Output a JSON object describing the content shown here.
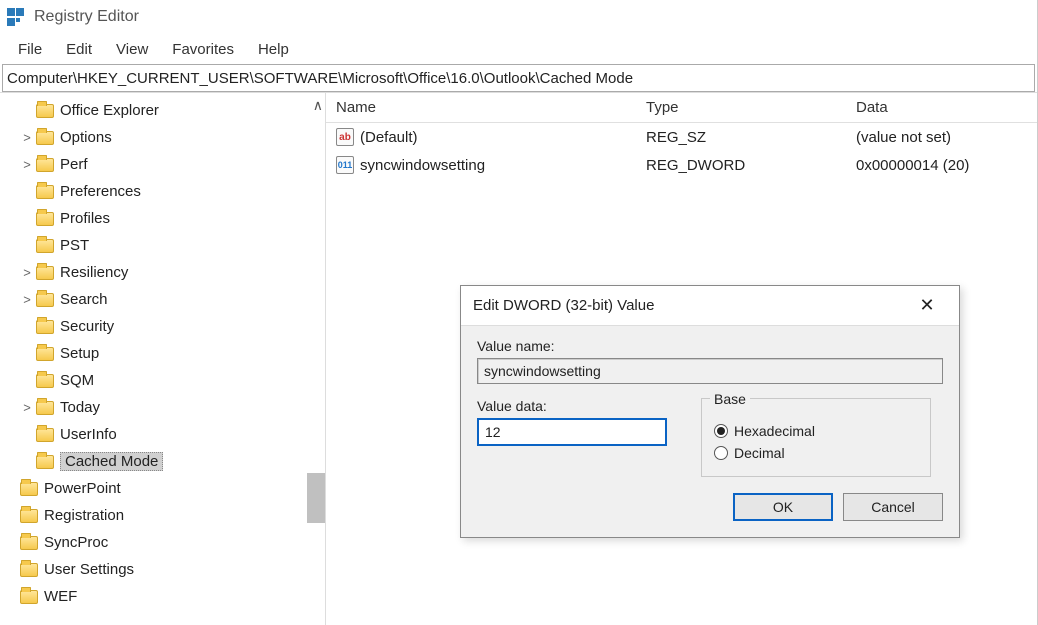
{
  "app": {
    "title": "Registry Editor"
  },
  "menu": {
    "items": [
      "File",
      "Edit",
      "View",
      "Favorites",
      "Help"
    ]
  },
  "address": {
    "path": "Computer\\HKEY_CURRENT_USER\\SOFTWARE\\Microsoft\\Office\\16.0\\Outlook\\Cached Mode"
  },
  "tree": {
    "items": [
      {
        "label": "Office Explorer",
        "exp": "",
        "depth": 1
      },
      {
        "label": "Options",
        "exp": ">",
        "depth": 1
      },
      {
        "label": "Perf",
        "exp": ">",
        "depth": 1
      },
      {
        "label": "Preferences",
        "exp": "",
        "depth": 1
      },
      {
        "label": "Profiles",
        "exp": "",
        "depth": 1
      },
      {
        "label": "PST",
        "exp": "",
        "depth": 1
      },
      {
        "label": "Resiliency",
        "exp": ">",
        "depth": 1
      },
      {
        "label": "Search",
        "exp": ">",
        "depth": 1
      },
      {
        "label": "Security",
        "exp": "",
        "depth": 1
      },
      {
        "label": "Setup",
        "exp": "",
        "depth": 1
      },
      {
        "label": "SQM",
        "exp": "",
        "depth": 1
      },
      {
        "label": "Today",
        "exp": ">",
        "depth": 1
      },
      {
        "label": "UserInfo",
        "exp": "",
        "depth": 1
      },
      {
        "label": "Cached Mode",
        "exp": "",
        "depth": 1,
        "selected": true
      },
      {
        "label": "PowerPoint",
        "exp": "",
        "depth": 0
      },
      {
        "label": "Registration",
        "exp": "",
        "depth": 0
      },
      {
        "label": "SyncProc",
        "exp": "",
        "depth": 0
      },
      {
        "label": "User Settings",
        "exp": "",
        "depth": 0
      },
      {
        "label": "WEF",
        "exp": "",
        "depth": 0
      }
    ]
  },
  "list": {
    "headers": {
      "name": "Name",
      "type": "Type",
      "data": "Data"
    },
    "rows": [
      {
        "icon": "ab",
        "icon_text": "ab",
        "name": "(Default)",
        "type": "REG_SZ",
        "data": "(value not set)"
      },
      {
        "icon": "num",
        "icon_text": "011",
        "name": "syncwindowsetting",
        "type": "REG_DWORD",
        "data": "0x00000014 (20)"
      }
    ]
  },
  "dialog": {
    "title": "Edit DWORD (32-bit) Value",
    "value_name_label": "Value name:",
    "value_name": "syncwindowsetting",
    "value_data_label": "Value data:",
    "value_data": "12",
    "base_label": "Base",
    "hex_label": "Hexadecimal",
    "dec_label": "Decimal",
    "ok": "OK",
    "cancel": "Cancel"
  }
}
